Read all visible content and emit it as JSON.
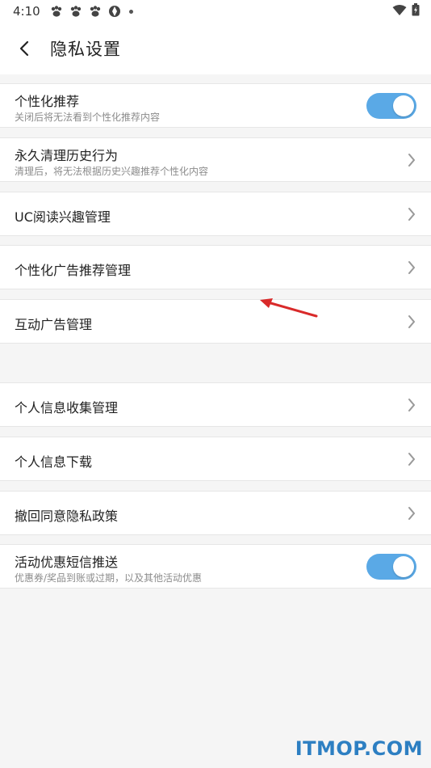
{
  "status_bar": {
    "time": "4:10",
    "app_icons": [
      "paw-icon",
      "paw-icon",
      "paw-icon",
      "aperture-icon"
    ],
    "right_icons": [
      "wifi-icon",
      "battery-icon"
    ]
  },
  "header": {
    "title": "隐私设置"
  },
  "items": [
    {
      "title": "个性化推荐",
      "subtitle": "关闭后将无法看到个性化推荐内容",
      "control": "toggle",
      "checked": true
    },
    {
      "title": "永久清理历史行为",
      "subtitle": "清理后，将无法根据历史兴趣推荐个性化内容",
      "control": "chevron"
    },
    {
      "title": "UC阅读兴趣管理",
      "control": "chevron"
    },
    {
      "title": "个性化广告推荐管理",
      "control": "chevron"
    },
    {
      "title": "互动广告管理",
      "control": "chevron"
    },
    {
      "title": "个人信息收集管理",
      "control": "chevron"
    },
    {
      "title": "个人信息下载",
      "control": "chevron"
    },
    {
      "title": "撤回同意隐私政策",
      "control": "chevron"
    },
    {
      "title": "活动优惠短信推送",
      "subtitle": "优惠券/奖品到账或过期，以及其他活动优惠",
      "control": "toggle",
      "checked": true
    }
  ],
  "colors": {
    "toggle_on": "#5aa9e6",
    "annotation_arrow": "#d92a2a",
    "watermark": "#2d7fc2"
  },
  "watermark": {
    "text": "ITMOP.COM"
  }
}
